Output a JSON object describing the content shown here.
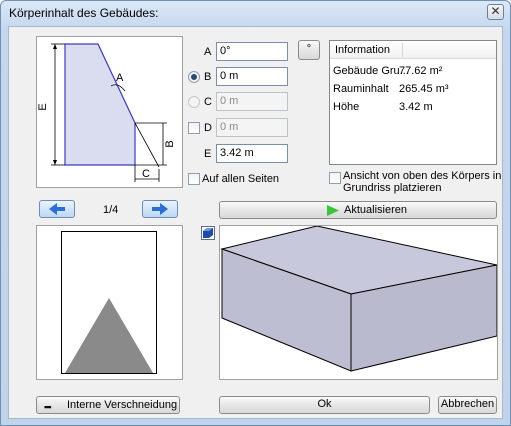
{
  "window": {
    "title": "Körperinhalt des Gebäudes:",
    "close_glyph": "✕"
  },
  "sketch": {
    "labels": {
      "A": "A",
      "B": "B",
      "C": "C",
      "E": "E"
    }
  },
  "params": {
    "A": {
      "label": "A",
      "value": "0°"
    },
    "B": {
      "label": "B",
      "value": "0 m"
    },
    "C": {
      "label": "C",
      "value": "0 m"
    },
    "D": {
      "label": "D",
      "value": "0 m"
    },
    "E": {
      "label": "E",
      "value": "3.42 m"
    },
    "degree_button": "°",
    "all_sides": "Auf allen Seiten"
  },
  "info": {
    "header": "Information",
    "rows": [
      {
        "key": "Gebäude Gru...",
        "value": "77.62 m²"
      },
      {
        "key": "Rauminhalt",
        "value": "265.45 m³"
      },
      {
        "key": "Höhe",
        "value": "3.42 m"
      }
    ]
  },
  "top_view_checkbox": "Ansicht von oben des Körpers in Grundriss platzieren",
  "nav": {
    "page": "1/4"
  },
  "update_button": "Aktualisieren",
  "bottom": {
    "intern": "Interne Verschneidung",
    "ok": "Ok",
    "cancel": "Abbrechen"
  },
  "colors": {
    "accent": "#3a78c9",
    "shape_fill": "#8a8a8a",
    "box_top": "#c7c8dc",
    "box_side": "#b9bace"
  }
}
